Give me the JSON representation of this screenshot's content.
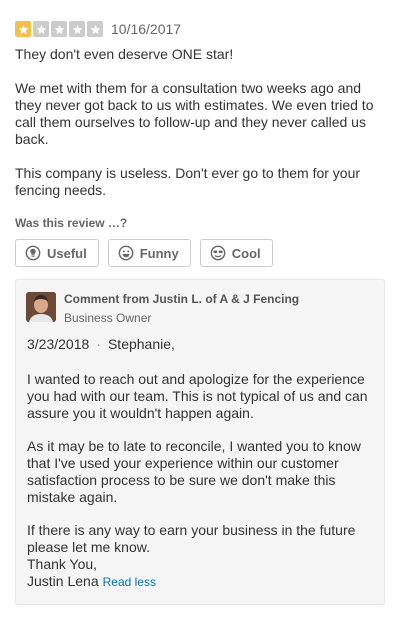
{
  "review": {
    "rating": 1,
    "max_rating": 5,
    "date": "10/16/2017",
    "paragraphs": [
      "They don't even deserve ONE star!",
      "We met with them for a consultation two weeks ago and they never got back to us with estimates.  We even tried to call them ourselves to follow-up and they never called us back.",
      "This company is useless.  Don't ever go to them for your fencing needs."
    ]
  },
  "votes": {
    "prompt": "Was this review …?",
    "buttons": [
      {
        "label": "Useful",
        "icon": "lightbulb-icon"
      },
      {
        "label": "Funny",
        "icon": "smiley-icon"
      },
      {
        "label": "Cool",
        "icon": "sunglasses-icon"
      }
    ]
  },
  "comment": {
    "title": "Comment from Justin L. of A & J Fencing",
    "role": "Business Owner",
    "date": "3/23/2018",
    "separator": "·",
    "greeting": "Stephanie,",
    "paragraphs": [
      "I wanted to reach out and apologize for the experience you had with our team. This is not typical of us and can assure you it wouldn't happen again.",
      "As it may be to late to reconcile,  I wanted you to know that I've used your experience within our customer satisfaction process to be sure we don't make this mistake again.",
      "If there is any way to earn your business in the future please let me know."
    ],
    "closing": "Thank You,",
    "signature": "Justin Lena",
    "read_less": "Read less"
  },
  "colors": {
    "star_on": "#f0c14b",
    "star_off": "#cccccc",
    "link": "#0073bb",
    "comment_bg": "#f5f5f5"
  }
}
